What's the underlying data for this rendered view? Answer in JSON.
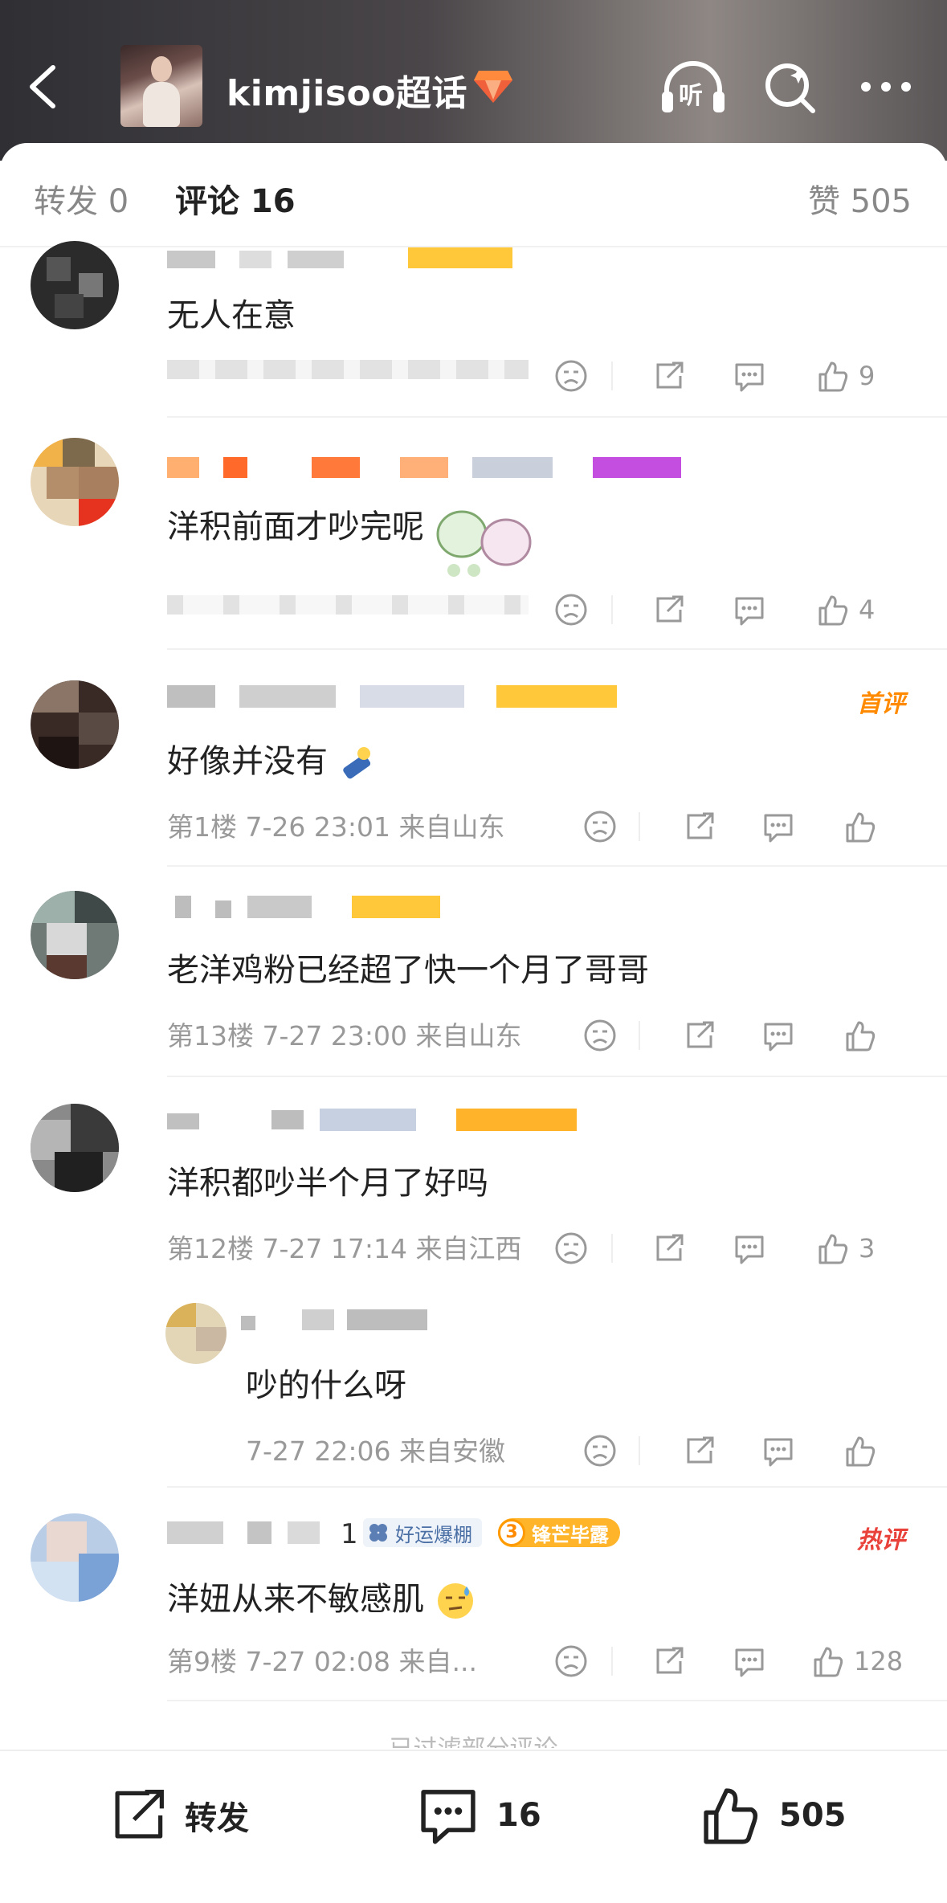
{
  "header": {
    "title": "kimjisoo超话",
    "listen_label": "听"
  },
  "tabs": {
    "repost": "转发 0",
    "comment": "评论 16",
    "likes": "赞 505"
  },
  "comments": [
    {
      "text": "无人在意",
      "meta": "",
      "like_count": "9"
    },
    {
      "text": "洋积前面才吵完呢",
      "meta": "",
      "like_count": "4"
    },
    {
      "text": "好像并没有",
      "meta": "第1楼  7-26 23:01  来自山东",
      "like_count": "",
      "tag": "首评"
    },
    {
      "text": "老洋鸡粉已经超了快一个月了哥哥",
      "meta": "第13楼  7-27 23:00  来自山东",
      "like_count": ""
    },
    {
      "text": "洋积都吵半个月了好吗",
      "meta": "第12楼  7-27 17:14  来自江西",
      "like_count": "3"
    },
    {
      "text": "吵的什么呀",
      "meta": "7-27 22:06  来自安徽",
      "like_count": ""
    },
    {
      "text": "洋妞从来不敏感肌",
      "meta": "第9楼  7-27 02:08  来自...",
      "like_count": "128",
      "tag": "热评",
      "level": "1",
      "badge1": "好运爆棚",
      "badge2": "锋芒毕露",
      "badge2_level": "3"
    }
  ],
  "filtered_notice": "已过滤部分评论",
  "bottom_bar": {
    "repost_label": "转发",
    "comment_count": "16",
    "like_count": "505"
  },
  "colors": {
    "accent_orange": "#ff8200",
    "hot_tag": "#e8423b",
    "first_tag": "#ff8a00",
    "muted": "#999999"
  }
}
